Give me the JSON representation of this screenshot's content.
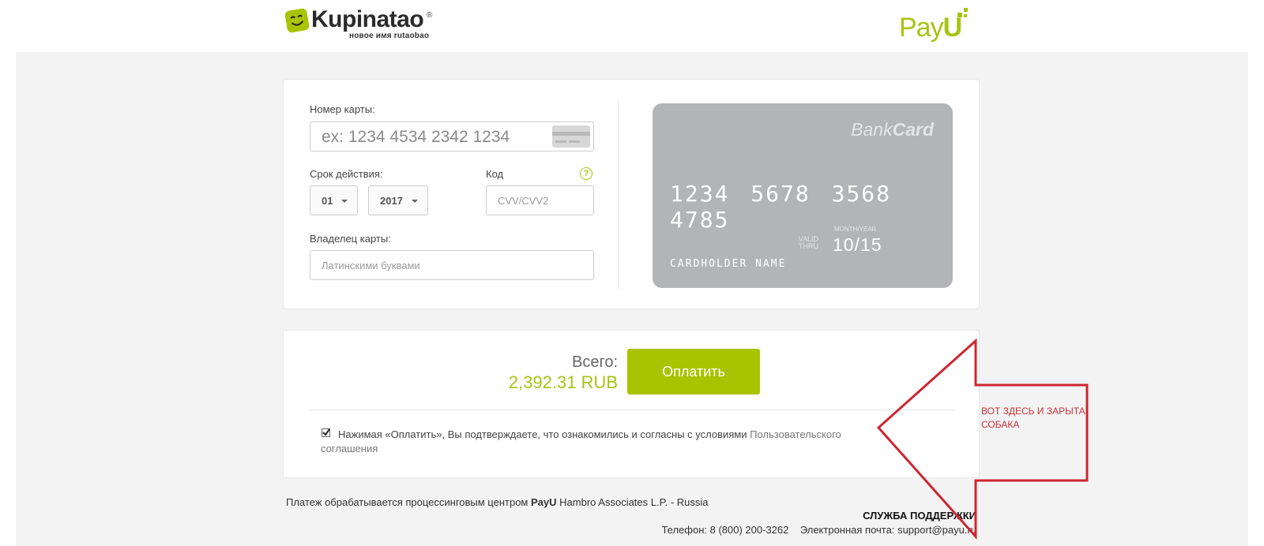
{
  "header": {
    "merchant_logo_name": "Kupinatao",
    "merchant_logo_sub": "новое имя rutaobao",
    "merchant_logo_reg": "®",
    "provider_logo_pre": "Pay",
    "provider_logo_u": "U",
    "brand_color": "#a8c400"
  },
  "card_form": {
    "card_number_label": "Номер карты:",
    "card_number_placeholder": "ex: 1234 4534 2342 1234",
    "expiry_label": "Срок действия:",
    "month_value": "01",
    "year_value": "2017",
    "code_label": "Код",
    "code_placeholder": "CVV/CVV2",
    "help_symbol": "?",
    "holder_label": "Владелец карты:",
    "holder_placeholder": "Латинскими буквами"
  },
  "card_preview": {
    "brand_light": "Bank",
    "brand_bold": "Card",
    "number": "1234 5678 3568 4785",
    "valid_thru_line1": "VALID",
    "valid_thru_line2": "THRU",
    "month_year_caption": "MONTH/YEAR",
    "expiry": "10/15",
    "holder": "CARDHOLDER NAME",
    "card_color": "#b3b4b6"
  },
  "payment": {
    "total_label": "Всего:",
    "total_amount": "2,392.31 RUB",
    "pay_button": "Оплатить",
    "agreement_checked": true,
    "agreement_text": "Нажимая «Оплатить», Вы подтверждаете, что ознакомились и согласны с условиями",
    "agreement_link_part1": "Пользовательского",
    "agreement_link_part2": "соглашения"
  },
  "footer": {
    "processing_prefix": "Платеж обрабатывается процессинговым центром",
    "processing_brand": "PayU",
    "processing_suffix": "Hambro Associates L.P. - Russia",
    "support_title": "СЛУЖБА ПОДДЕРЖКИ",
    "phone_label": "Телефон:",
    "phone": "8 (800) 200-3262",
    "email_label": "Электронная почта:",
    "email": "support@payu.ru"
  },
  "annotation": {
    "text_line1": "ВОТ ЗДЕСЬ И ЗАРЫТА",
    "text_line2": "СОБАКА",
    "color": "#c8323a"
  }
}
